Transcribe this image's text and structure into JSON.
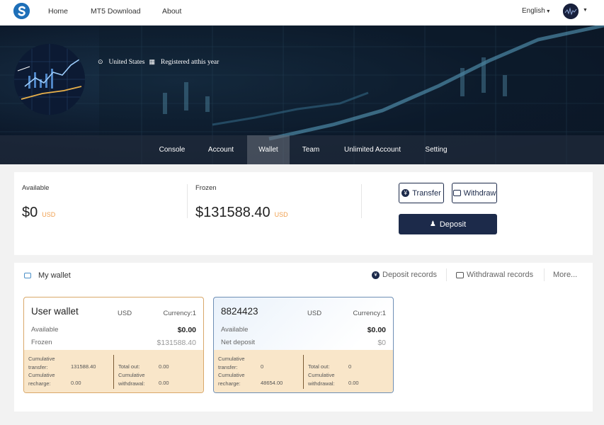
{
  "nav": {
    "links": [
      "Home",
      "MT5 Download",
      "About"
    ],
    "language": "English"
  },
  "profile": {
    "location": "United States",
    "registered": "Registered atthis year"
  },
  "tabs": [
    "Console",
    "Account",
    "Wallet",
    "Team",
    "Unlimited Account",
    "Setting"
  ],
  "active_tab": "Wallet",
  "balance": {
    "available_label": "Available",
    "available_value": "$0",
    "frozen_label": "Frozen",
    "frozen_value": "$131588.40",
    "currency": "USD",
    "transfer_label": "Transfer",
    "withdraw_label": "Withdraw",
    "deposit_label": "Deposit"
  },
  "my_wallet": {
    "title": "My wallet",
    "deposit_records": "Deposit records",
    "withdrawal_records": "Withdrawal records",
    "more": "More..."
  },
  "wallets": [
    {
      "title": "User wallet",
      "currency": "USD",
      "currency_rate": "Currency:1",
      "row1_label": "Available",
      "row1_value": "$0.00",
      "row2_label": "Frozen",
      "row2_value": "$131588.40",
      "stats": {
        "cum_transfer_label": "Cumulative transfer:",
        "cum_transfer_value": "131588.40",
        "cum_recharge_label": "Cumulative recharge:",
        "cum_recharge_value": "0.00",
        "total_out_label": "Total out:",
        "total_out_value": "0.00",
        "cum_withdrawal_label": "Cumulative withdrawal:",
        "cum_withdrawal_value": "0.00"
      }
    },
    {
      "title": "8824423",
      "currency": "USD",
      "currency_rate": "Currency:1",
      "row1_label": "Available",
      "row1_value": "$0.00",
      "row2_label": "Net deposit",
      "row2_value": "$0",
      "stats": {
        "cum_transfer_label": "Cumulative transfer:",
        "cum_transfer_value": "0",
        "cum_recharge_label": "Cumulative recharge:",
        "cum_recharge_value": "48654.00",
        "total_out_label": "Total out:",
        "total_out_value": "0",
        "cum_withdrawal_label": "Cumulative withdrawal:",
        "cum_withdrawal_value": "0.00"
      }
    }
  ],
  "colors": {
    "navy": "#1c2a4a",
    "accent_orange": "#f0a050",
    "footer_beige": "#f9e6c9"
  }
}
